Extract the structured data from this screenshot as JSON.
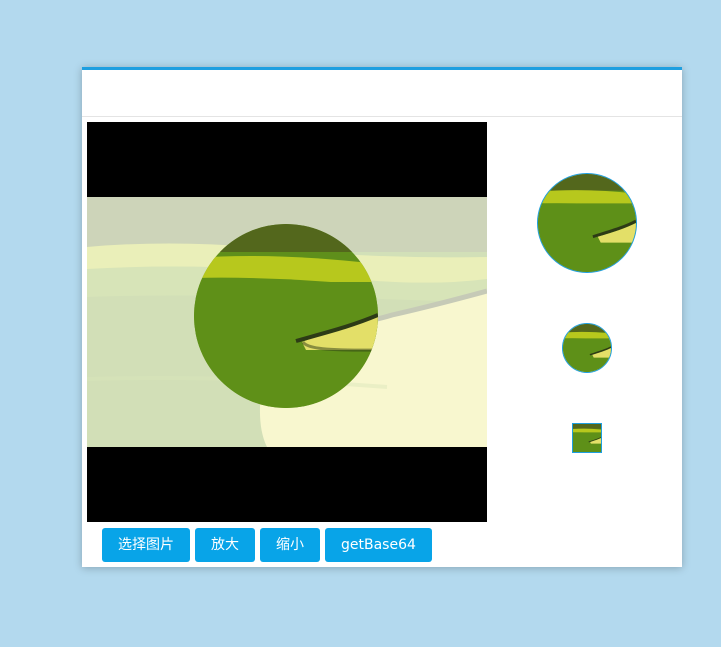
{
  "toolbar": {
    "select_label": "选择图片",
    "zoom_in_label": "放大",
    "zoom_out_label": "缩小",
    "base64_label": "getBase64"
  },
  "colors": {
    "accent": "#08a4e8",
    "dialog_top_border": "#1e9fe0",
    "page_background": "#b3d9ee"
  }
}
